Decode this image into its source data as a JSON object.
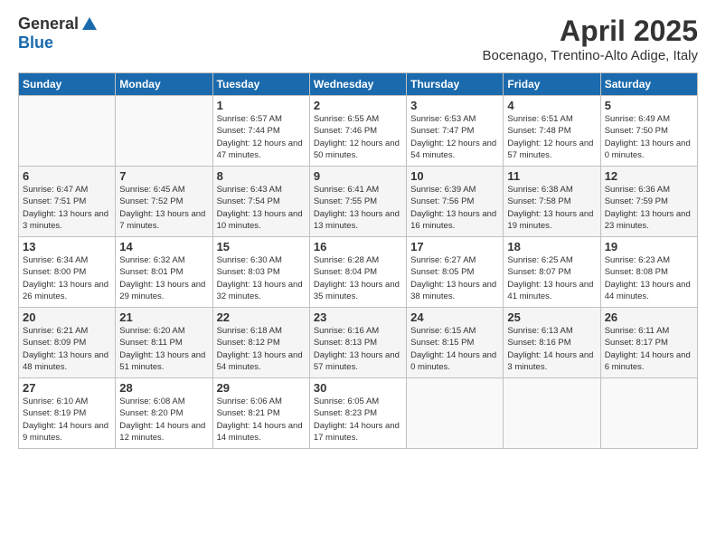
{
  "header": {
    "logo_general": "General",
    "logo_blue": "Blue",
    "month_title": "April 2025",
    "location": "Bocenago, Trentino-Alto Adige, Italy"
  },
  "days_of_week": [
    "Sunday",
    "Monday",
    "Tuesday",
    "Wednesday",
    "Thursday",
    "Friday",
    "Saturday"
  ],
  "weeks": [
    [
      {
        "day": "",
        "info": ""
      },
      {
        "day": "",
        "info": ""
      },
      {
        "day": "1",
        "info": "Sunrise: 6:57 AM\nSunset: 7:44 PM\nDaylight: 12 hours and 47 minutes."
      },
      {
        "day": "2",
        "info": "Sunrise: 6:55 AM\nSunset: 7:46 PM\nDaylight: 12 hours and 50 minutes."
      },
      {
        "day": "3",
        "info": "Sunrise: 6:53 AM\nSunset: 7:47 PM\nDaylight: 12 hours and 54 minutes."
      },
      {
        "day": "4",
        "info": "Sunrise: 6:51 AM\nSunset: 7:48 PM\nDaylight: 12 hours and 57 minutes."
      },
      {
        "day": "5",
        "info": "Sunrise: 6:49 AM\nSunset: 7:50 PM\nDaylight: 13 hours and 0 minutes."
      }
    ],
    [
      {
        "day": "6",
        "info": "Sunrise: 6:47 AM\nSunset: 7:51 PM\nDaylight: 13 hours and 3 minutes."
      },
      {
        "day": "7",
        "info": "Sunrise: 6:45 AM\nSunset: 7:52 PM\nDaylight: 13 hours and 7 minutes."
      },
      {
        "day": "8",
        "info": "Sunrise: 6:43 AM\nSunset: 7:54 PM\nDaylight: 13 hours and 10 minutes."
      },
      {
        "day": "9",
        "info": "Sunrise: 6:41 AM\nSunset: 7:55 PM\nDaylight: 13 hours and 13 minutes."
      },
      {
        "day": "10",
        "info": "Sunrise: 6:39 AM\nSunset: 7:56 PM\nDaylight: 13 hours and 16 minutes."
      },
      {
        "day": "11",
        "info": "Sunrise: 6:38 AM\nSunset: 7:58 PM\nDaylight: 13 hours and 19 minutes."
      },
      {
        "day": "12",
        "info": "Sunrise: 6:36 AM\nSunset: 7:59 PM\nDaylight: 13 hours and 23 minutes."
      }
    ],
    [
      {
        "day": "13",
        "info": "Sunrise: 6:34 AM\nSunset: 8:00 PM\nDaylight: 13 hours and 26 minutes."
      },
      {
        "day": "14",
        "info": "Sunrise: 6:32 AM\nSunset: 8:01 PM\nDaylight: 13 hours and 29 minutes."
      },
      {
        "day": "15",
        "info": "Sunrise: 6:30 AM\nSunset: 8:03 PM\nDaylight: 13 hours and 32 minutes."
      },
      {
        "day": "16",
        "info": "Sunrise: 6:28 AM\nSunset: 8:04 PM\nDaylight: 13 hours and 35 minutes."
      },
      {
        "day": "17",
        "info": "Sunrise: 6:27 AM\nSunset: 8:05 PM\nDaylight: 13 hours and 38 minutes."
      },
      {
        "day": "18",
        "info": "Sunrise: 6:25 AM\nSunset: 8:07 PM\nDaylight: 13 hours and 41 minutes."
      },
      {
        "day": "19",
        "info": "Sunrise: 6:23 AM\nSunset: 8:08 PM\nDaylight: 13 hours and 44 minutes."
      }
    ],
    [
      {
        "day": "20",
        "info": "Sunrise: 6:21 AM\nSunset: 8:09 PM\nDaylight: 13 hours and 48 minutes."
      },
      {
        "day": "21",
        "info": "Sunrise: 6:20 AM\nSunset: 8:11 PM\nDaylight: 13 hours and 51 minutes."
      },
      {
        "day": "22",
        "info": "Sunrise: 6:18 AM\nSunset: 8:12 PM\nDaylight: 13 hours and 54 minutes."
      },
      {
        "day": "23",
        "info": "Sunrise: 6:16 AM\nSunset: 8:13 PM\nDaylight: 13 hours and 57 minutes."
      },
      {
        "day": "24",
        "info": "Sunrise: 6:15 AM\nSunset: 8:15 PM\nDaylight: 14 hours and 0 minutes."
      },
      {
        "day": "25",
        "info": "Sunrise: 6:13 AM\nSunset: 8:16 PM\nDaylight: 14 hours and 3 minutes."
      },
      {
        "day": "26",
        "info": "Sunrise: 6:11 AM\nSunset: 8:17 PM\nDaylight: 14 hours and 6 minutes."
      }
    ],
    [
      {
        "day": "27",
        "info": "Sunrise: 6:10 AM\nSunset: 8:19 PM\nDaylight: 14 hours and 9 minutes."
      },
      {
        "day": "28",
        "info": "Sunrise: 6:08 AM\nSunset: 8:20 PM\nDaylight: 14 hours and 12 minutes."
      },
      {
        "day": "29",
        "info": "Sunrise: 6:06 AM\nSunset: 8:21 PM\nDaylight: 14 hours and 14 minutes."
      },
      {
        "day": "30",
        "info": "Sunrise: 6:05 AM\nSunset: 8:23 PM\nDaylight: 14 hours and 17 minutes."
      },
      {
        "day": "",
        "info": ""
      },
      {
        "day": "",
        "info": ""
      },
      {
        "day": "",
        "info": ""
      }
    ]
  ]
}
